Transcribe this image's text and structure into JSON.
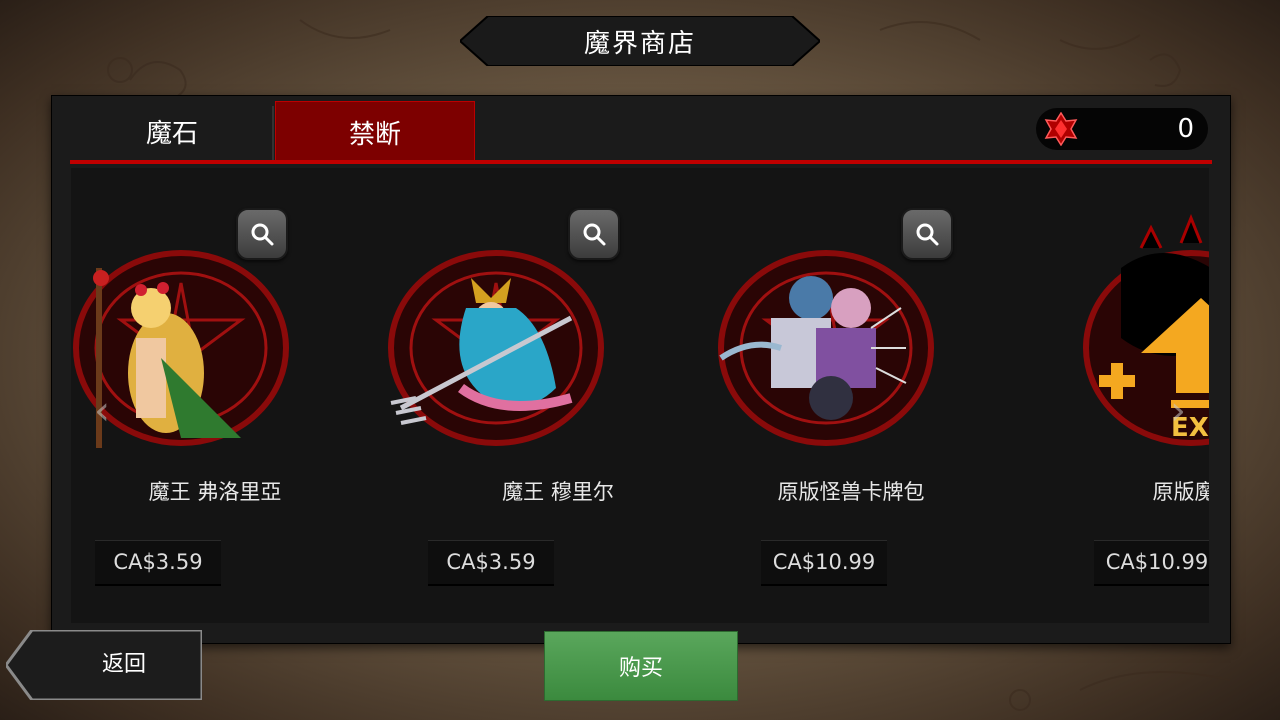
{
  "title": "魔界商店",
  "tabs": [
    {
      "label": "魔石",
      "active": false
    },
    {
      "label": "禁断",
      "active": true
    }
  ],
  "currency": {
    "icon": "red-gem-icon",
    "amount": "0"
  },
  "items": [
    {
      "name": "魔王 弗洛里亞",
      "price": "CA$3.59",
      "has_zoom": true
    },
    {
      "name": "魔王 穆里尔",
      "price": "CA$3.59",
      "has_zoom": true
    },
    {
      "name": "原版怪兽卡牌包",
      "price": "CA$10.99",
      "has_zoom": true
    },
    {
      "name": "原版魔王加速卡",
      "price": "CA$10.99",
      "has_zoom": false
    }
  ],
  "nav": {
    "prev_icon": "chevron-left-icon",
    "next_icon": "chevron-right-icon"
  },
  "buttons": {
    "back": "返回",
    "buy": "购买"
  },
  "colors": {
    "accent_red": "#c00000",
    "tab_active": "#7d0000",
    "buy_green": "#4a9a4d"
  }
}
